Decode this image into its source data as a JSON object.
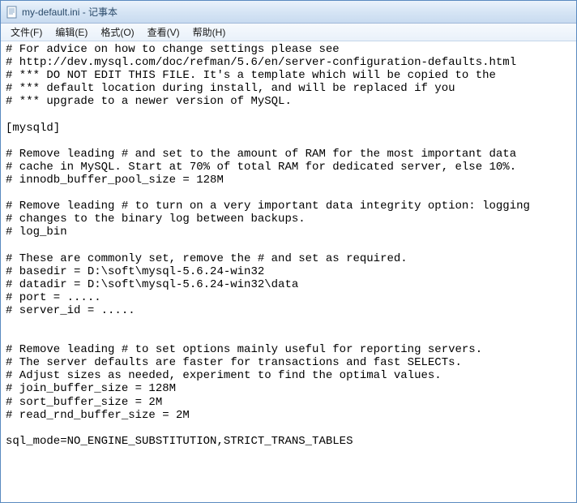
{
  "window": {
    "title": "my-default.ini - 记事本"
  },
  "menu": {
    "items": [
      {
        "label": "文件(F)"
      },
      {
        "label": "编辑(E)"
      },
      {
        "label": "格式(O)"
      },
      {
        "label": "查看(V)"
      },
      {
        "label": "帮助(H)"
      }
    ]
  },
  "editor": {
    "text": "# For advice on how to change settings please see\n# http://dev.mysql.com/doc/refman/5.6/en/server-configuration-defaults.html\n# *** DO NOT EDIT THIS FILE. It's a template which will be copied to the\n# *** default location during install, and will be replaced if you\n# *** upgrade to a newer version of MySQL.\n\n[mysqld]\n\n# Remove leading # and set to the amount of RAM for the most important data\n# cache in MySQL. Start at 70% of total RAM for dedicated server, else 10%.\n# innodb_buffer_pool_size = 128M\n\n# Remove leading # to turn on a very important data integrity option: logging\n# changes to the binary log between backups.\n# log_bin\n\n# These are commonly set, remove the # and set as required.\n# basedir = D:\\soft\\mysql-5.6.24-win32\n# datadir = D:\\soft\\mysql-5.6.24-win32\\data\n# port = .....\n# server_id = .....\n\n\n# Remove leading # to set options mainly useful for reporting servers.\n# The server defaults are faster for transactions and fast SELECTs.\n# Adjust sizes as needed, experiment to find the optimal values.\n# join_buffer_size = 128M\n# sort_buffer_size = 2M\n# read_rnd_buffer_size = 2M\n\nsql_mode=NO_ENGINE_SUBSTITUTION,STRICT_TRANS_TABLES"
  }
}
